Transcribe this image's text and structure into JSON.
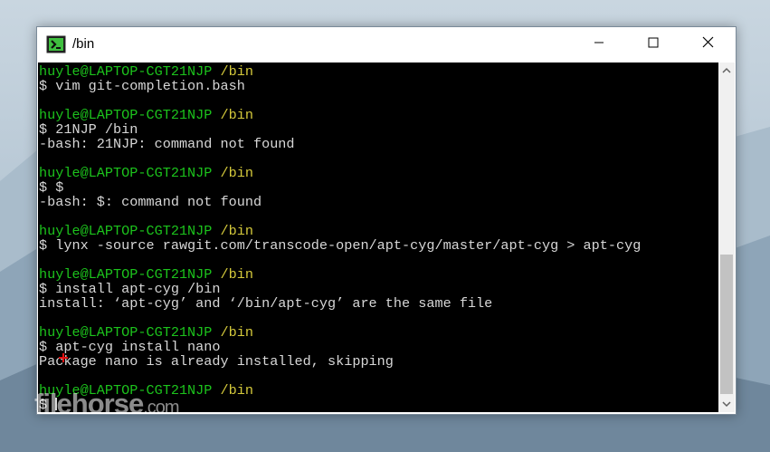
{
  "window": {
    "title": "/bin",
    "controls": {
      "minimize": "minimize-icon",
      "maximize": "maximize-icon",
      "close": "close-icon"
    }
  },
  "colors": {
    "prompt_user": "#1cc31c",
    "prompt_path": "#d4c93b",
    "text": "#d7d7d7",
    "background": "#000000"
  },
  "terminal": {
    "lines": [
      {
        "type": "prompt",
        "user": "huyle@LAPTOP-CGT21NJP",
        "path": "/bin"
      },
      {
        "type": "text",
        "text": "$ vim git-completion.bash"
      },
      {
        "type": "blank",
        "text": ""
      },
      {
        "type": "prompt",
        "user": "huyle@LAPTOP-CGT21NJP",
        "path": "/bin"
      },
      {
        "type": "text",
        "text": "$ 21NJP /bin"
      },
      {
        "type": "text",
        "text": "-bash: 21NJP: command not found"
      },
      {
        "type": "blank",
        "text": ""
      },
      {
        "type": "prompt",
        "user": "huyle@LAPTOP-CGT21NJP",
        "path": "/bin"
      },
      {
        "type": "text",
        "text": "$ $"
      },
      {
        "type": "text",
        "text": "-bash: $: command not found"
      },
      {
        "type": "blank",
        "text": ""
      },
      {
        "type": "prompt",
        "user": "huyle@LAPTOP-CGT21NJP",
        "path": "/bin"
      },
      {
        "type": "text",
        "text": "$ lynx -source rawgit.com/transcode-open/apt-cyg/master/apt-cyg > apt-cyg"
      },
      {
        "type": "blank",
        "text": ""
      },
      {
        "type": "prompt",
        "user": "huyle@LAPTOP-CGT21NJP",
        "path": "/bin"
      },
      {
        "type": "text",
        "text": "$ install apt-cyg /bin"
      },
      {
        "type": "text",
        "text": "install: ‘apt-cyg’ and ‘/bin/apt-cyg’ are the same file"
      },
      {
        "type": "blank",
        "text": ""
      },
      {
        "type": "prompt",
        "user": "huyle@LAPTOP-CGT21NJP",
        "path": "/bin"
      },
      {
        "type": "text",
        "text": "$ apt-cyg install nano"
      },
      {
        "type": "text",
        "text": "Package nano is already installed, skipping"
      },
      {
        "type": "blank",
        "text": ""
      },
      {
        "type": "prompt",
        "user": "huyle@LAPTOP-CGT21NJP",
        "path": "/bin"
      },
      {
        "type": "input",
        "text": "$ "
      }
    ]
  },
  "scrollbar": {
    "up": "chevron-up-icon",
    "down": "chevron-down-icon"
  },
  "watermark": {
    "brand": "filehorse",
    "domain": ".com"
  }
}
